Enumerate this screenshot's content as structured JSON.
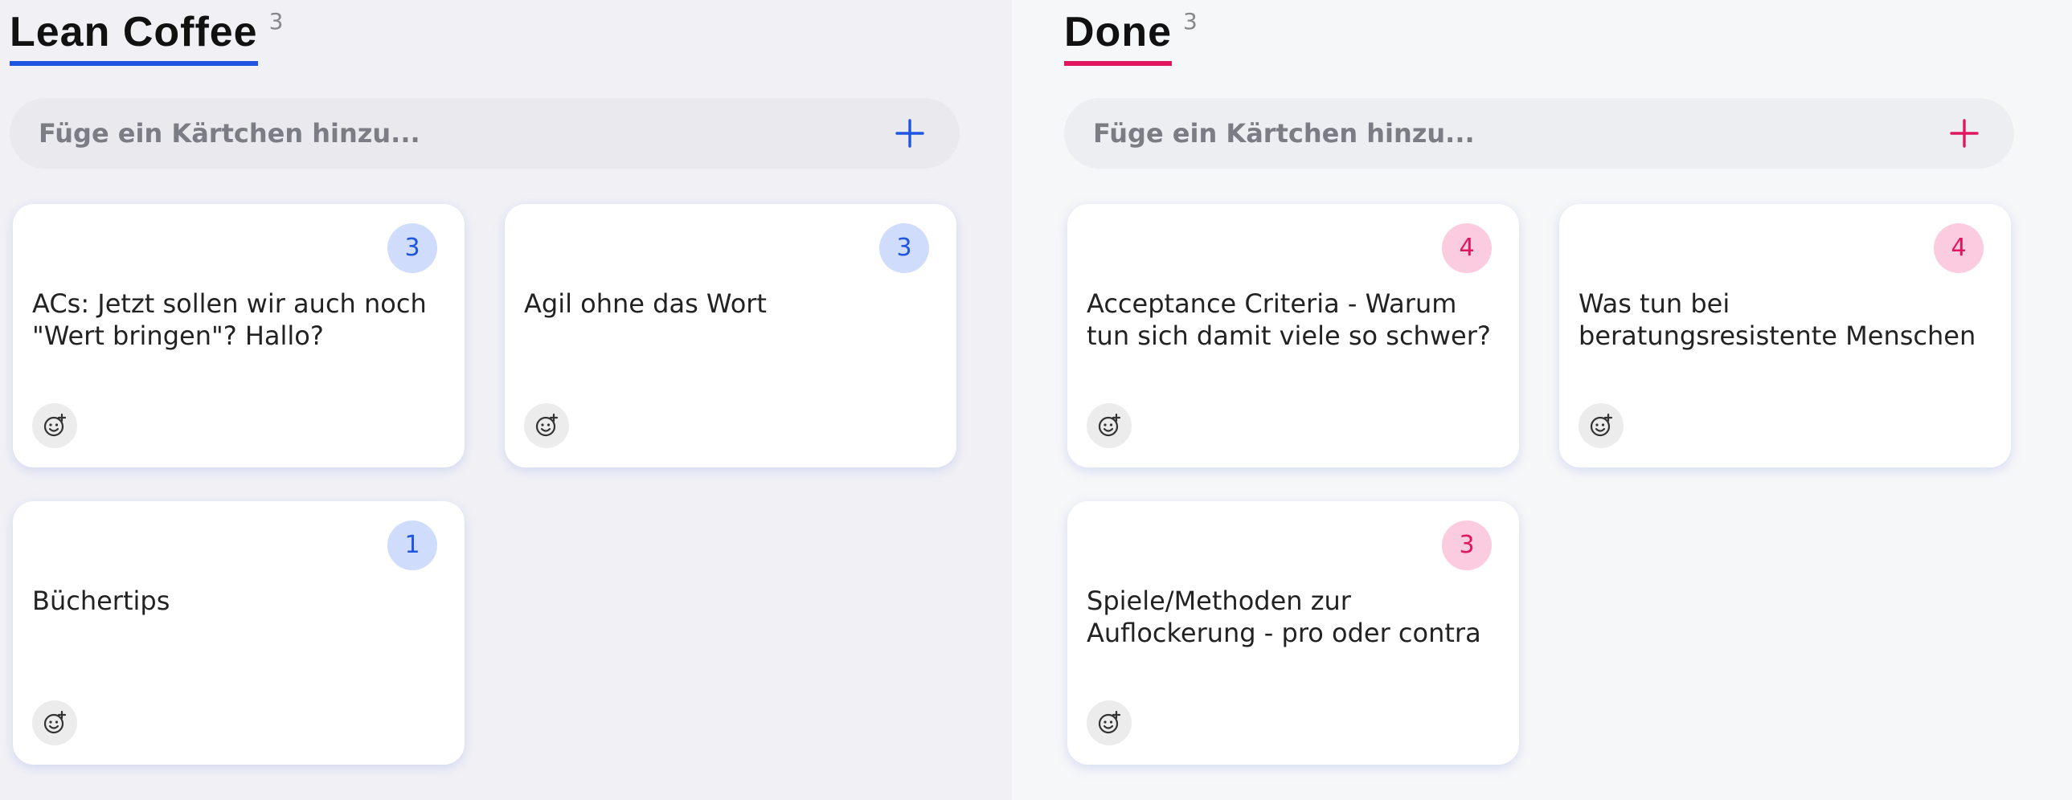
{
  "colors": {
    "lean_accent": "#1f55e0",
    "done_accent": "#e0175f"
  },
  "columns": [
    {
      "title": "Lean Coffee",
      "count": "3",
      "add_placeholder": "Füge ein Kärtchen hinzu...",
      "cards": [
        {
          "votes": "3",
          "text": "ACs: Jetzt sollen wir auch noch \"Wert bringen\"? Hallo?"
        },
        {
          "votes": "3",
          "text": "Agil ohne das Wort"
        },
        {
          "votes": "1",
          "text": "Büchertips"
        }
      ]
    },
    {
      "title": "Done",
      "count": "3",
      "add_placeholder": "Füge ein Kärtchen hinzu...",
      "cards": [
        {
          "votes": "4",
          "text": "Acceptance Criteria - Warum tun sich damit viele so schwer?"
        },
        {
          "votes": "4",
          "text": "Was tun bei beratungsresistente Menschen"
        },
        {
          "votes": "3",
          "text": "Spiele/Methoden zur Auflockerung - pro oder contra"
        }
      ]
    }
  ],
  "icons": {
    "add": "plus-icon",
    "reaction": "add-emoji-icon"
  }
}
